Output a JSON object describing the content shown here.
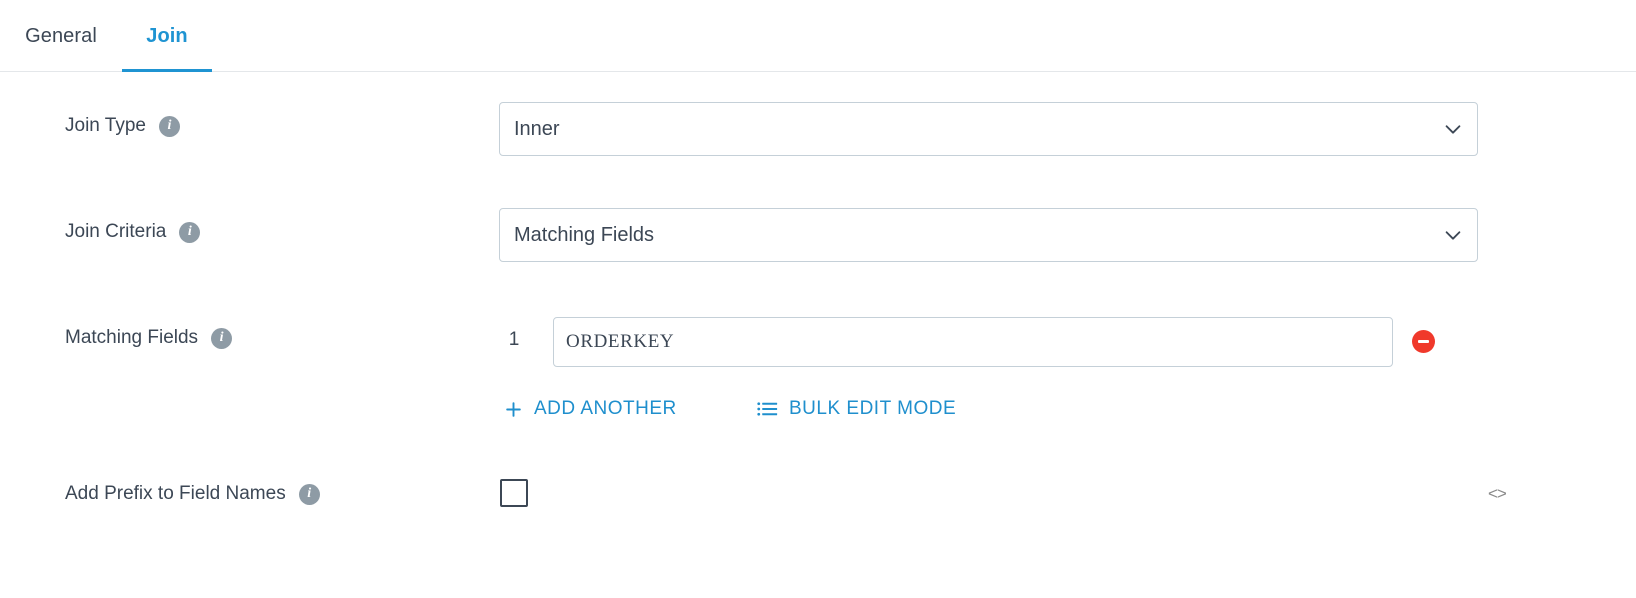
{
  "tabs": [
    {
      "label": "General",
      "active": false
    },
    {
      "label": "Join",
      "active": true
    }
  ],
  "colors": {
    "accent": "#1f94d2",
    "link": "#1f8fcd",
    "text": "#3c4755",
    "info_icon_bg": "#8e9ba5",
    "remove_button_bg": "#f0392b",
    "border": "#c5d0d8",
    "divider": "#e4e7ea"
  },
  "form": {
    "join_type": {
      "label": "Join Type",
      "info_glyph": "i",
      "value": "Inner"
    },
    "join_criteria": {
      "label": "Join Criteria",
      "info_glyph": "i",
      "value": "Matching Fields"
    },
    "matching_fields": {
      "label": "Matching Fields",
      "info_glyph": "i",
      "rows": [
        {
          "index": "1",
          "value": "ORDERKEY",
          "remove_label": ""
        }
      ],
      "add_another_label": "ADD ANOTHER",
      "bulk_edit_label": "BULK EDIT MODE"
    },
    "add_prefix": {
      "label": "Add Prefix to Field Names",
      "info_glyph": "i",
      "checked": false
    },
    "code_view_label": "<>"
  }
}
